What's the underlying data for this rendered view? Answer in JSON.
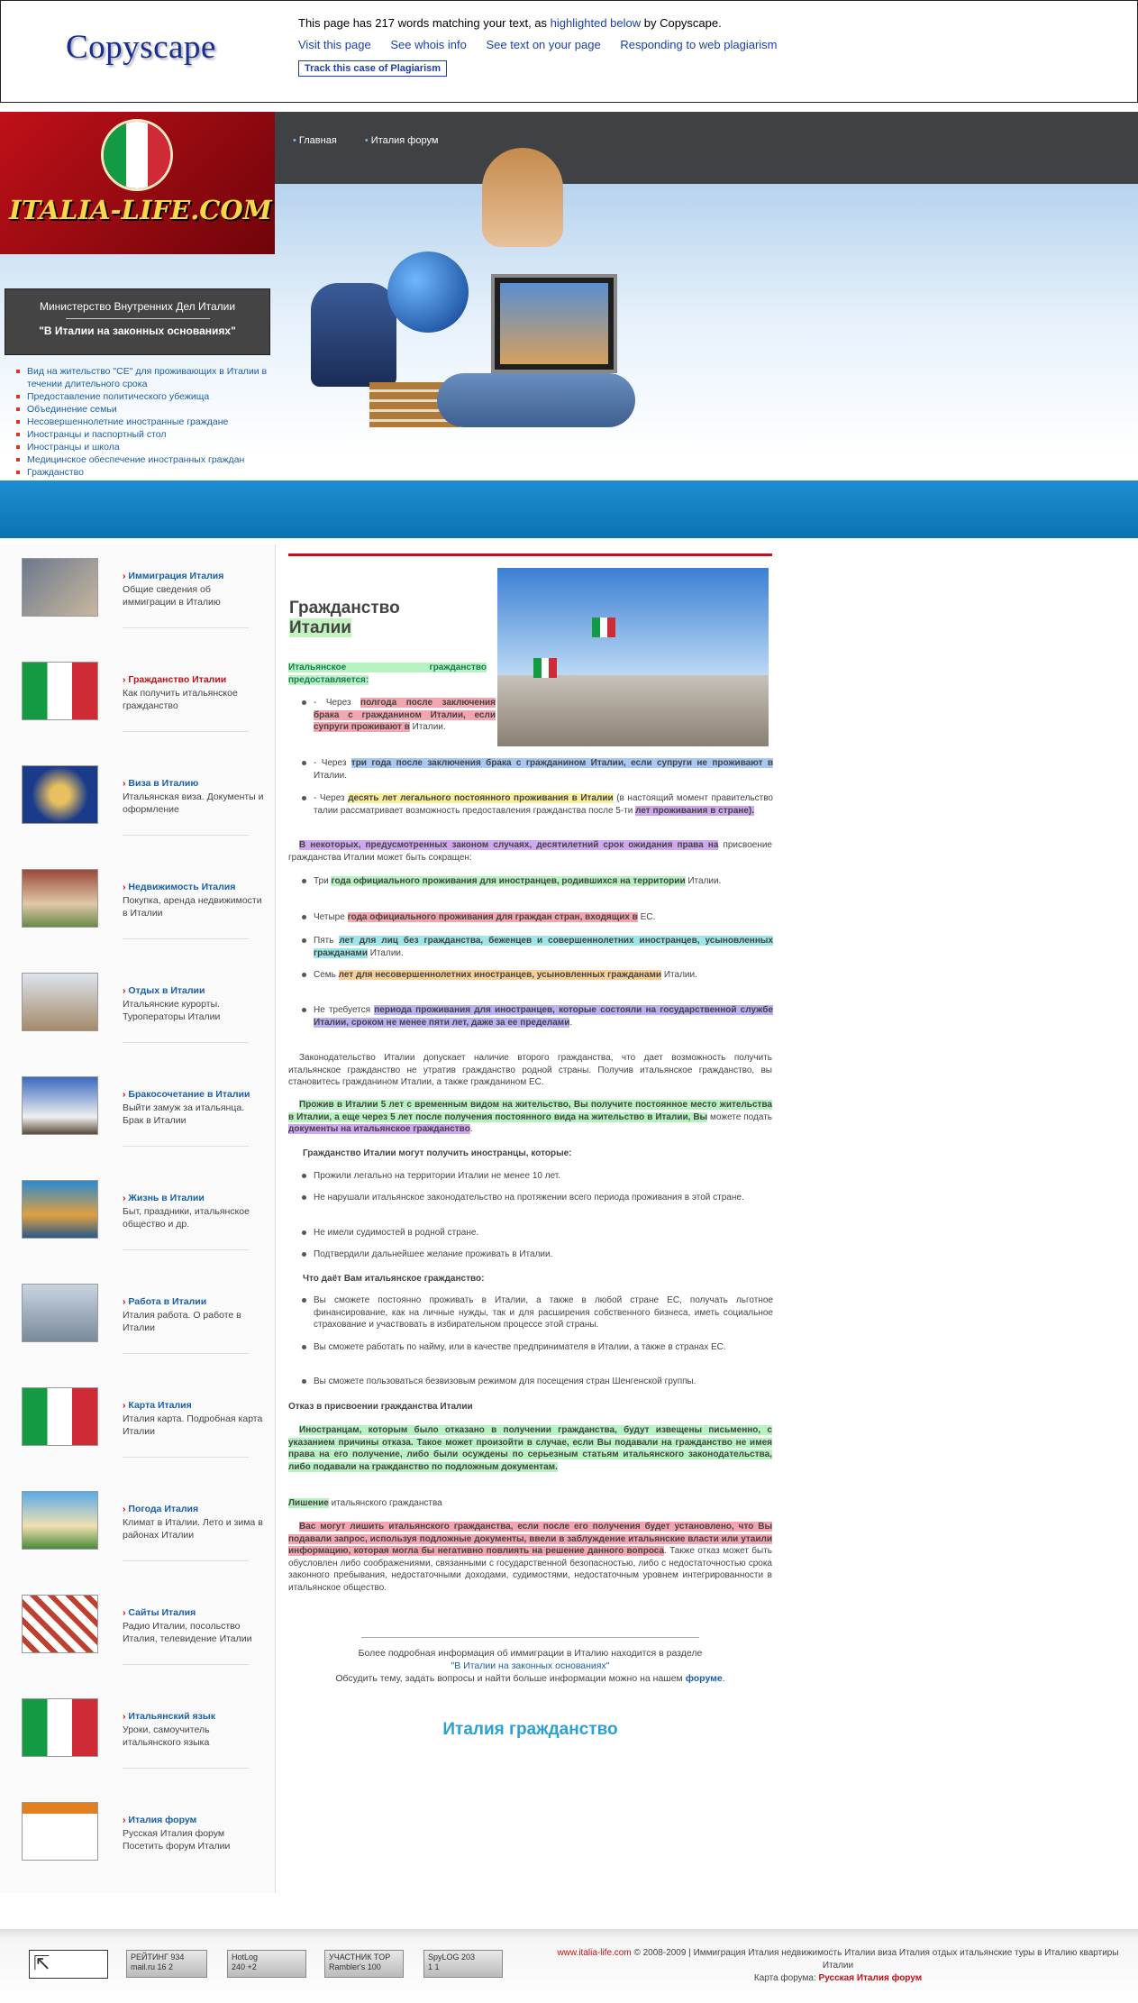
{
  "copyscape": {
    "logo": "Copyscape",
    "message_pre": "This page has 217 words matching your text, as ",
    "message_link": "highlighted below",
    "message_post": " by Copyscape.",
    "links": [
      "Visit this page",
      "See whois info",
      "See text on your page",
      "Responding to web plagiarism"
    ],
    "track_button": "Track this case of Plagiarism"
  },
  "header": {
    "logo_text": "ITALIA-LIFE.COM",
    "nav": [
      "Главная",
      "Италия форум"
    ],
    "ministry_title": "Министерство Внутренних Дел Италии",
    "ministry_subtitle": "\"В Италии на законных основаниях\"",
    "side_links": [
      "Вид на жительство \"CE\" для проживающих в Италии в течении длительного срока",
      "Предоставление политического убежища",
      "Объединение семьи",
      "Несовершеннолетние иностранные граждане",
      "Иностранцы и паспортный стол",
      "Иностранцы и школа",
      "Медицинское обеспечение иностранных граждан",
      "Гражданство"
    ]
  },
  "left_menu": [
    {
      "title": "Иммиграция Италия",
      "desc": "Общие сведения об иммиграции в Италию"
    },
    {
      "title": "Гражданство Италии",
      "desc": "Как получить итальянское гражданство"
    },
    {
      "title": "Виза в Италию",
      "desc": "Итальянская виза. Документы и оформление"
    },
    {
      "title": "Недвижимость Италия",
      "desc": "Покупка, аренда недвижимости в Италии"
    },
    {
      "title": "Отдых в Италии",
      "desc": "Итальянские курорты. Туроператоры Италии"
    },
    {
      "title": "Бракосочетание в Италии",
      "desc": "Выйти замуж за итальянца. Брак в Италии"
    },
    {
      "title": "Жизнь в Италии",
      "desc": "Быт, праздники, итальянское общество и др."
    },
    {
      "title": "Работа в Италии",
      "desc": "Италия работа. О работе в Италии"
    },
    {
      "title": "Карта Италия",
      "desc": "Италия карта. Подробная карта Италии"
    },
    {
      "title": "Погода Италия",
      "desc": "Климат в Италии. Лето и зима в районах Италии"
    },
    {
      "title": "Сайты Италия",
      "desc": "Радио Италии, посольство Италия, телевидение Италии"
    },
    {
      "title": "Итальянский язык",
      "desc": "Уроки, самоучитель итальянского языка"
    },
    {
      "title": "Италия форум",
      "desc": "Русская Италия форум Посетить форум Италии"
    }
  ],
  "content": {
    "title_line1": "Гражданство",
    "title_line2": "Италии",
    "intro": "Итальянское гражданство предоставляется:",
    "b1_a": "- Через ",
    "b1_b": "полгода после заключения брака с гражданином Италии, если супруги проживают в",
    "b1_c": " Италии.",
    "b2_a": "- Через ",
    "b2_b": "три года после заключения брака с гражданином Италии, если супруги не проживают в",
    "b2_c": " Италии.",
    "b3_a": "- Через ",
    "b3_b": "десять лет легального постоянного проживания в Италии",
    "b3_c": " (в настоящий момент правительство талии рассматривает возможность предоставления гражданства после 5-ти ",
    "b3_d": "лет проживания в стране).",
    "p1_a": "В некоторых, предусмотренных законом случаях, десятилетний срок ожидания права на",
    "p1_b": " присвоение гражданства Италии может быть сокращен:",
    "l1_a": "Три ",
    "l1_b": "года официального проживания для иностранцев, родившихся на территории",
    "l1_c": " Италии.",
    "l2_a": "Четыре ",
    "l2_b": "года официального проживания для граждан стран, входящих в",
    "l2_c": " ЕС.",
    "l3_a": "Пять ",
    "l3_b": "лет для лиц без гражданства, беженцев и совершеннолетних иностранцев, усыновленных гражданами",
    "l3_c": " Италии.",
    "l4_a": "Семь ",
    "l4_b": "лет для несовершеннолетних иностранцев, усыновленных гражданами",
    "l4_c": " Италии.",
    "l5_a": "Не требуется ",
    "l5_b": "периода проживания для иностранцев, которые состояли на государственной службе Италии, сроком не менее пяти лет, даже за ее пределами",
    "l5_c": ".",
    "p2": "Законодательство Италии допускает наличие второго гражданства, что дает возможность получить итальянское гражданство не утратив гражданство родной страны. Получив итальянское гражданство, вы становитесь гражданином Италии, а также гражданином ЕС.",
    "p3_a": "Прожив в Италии 5 лет с временным видом на жительство, Вы получите постоянное место жительства в Италии, а еще через 5 лет после получения постоянного вида на жительство в Италии, Вы",
    "p3_b": " можете подать ",
    "p3_c": "документы на итальянское гражданство",
    "p3_d": ".",
    "h_can": "Гражданство Италии могут получить иностранцы, которые:",
    "c1": "Прожили легально на территории Италии не менее 10 лет.",
    "c2": "Не нарушали итальянское законодательство на протяжении всего периода проживания в этой стране.",
    "c3": "Не имели судимостей в родной стране.",
    "c4": "Подтвердили дальнейшее желание проживать в Италии.",
    "h_gives": "Что даёт Вам итальянское гражданство:",
    "g1": "Вы сможете постоянно проживать в Италии, а также в любой стране ЕС, получать льготное финансирование, как на личные нужды, так и для расширения собственного бизнеса, иметь социальное страхование и участвовать в избирательном процессе этой страны.",
    "g2": "Вы сможете работать по найму, или в качестве предпринимателя в Италии, а также в странах ЕС.",
    "g3": "Вы сможете пользоваться безвизовым режимом для посещения стран Шенгенской группы.",
    "h_refusal": "Отказ в присвоении гражданства Италии",
    "p4": "Иностранцам, которым было отказано в получении гражданства, будут извещены письменно, с указанием причины отказа. Такое может произойти в случае, если Вы подавали на гражданство не имея права на его получение, либо были осуждены по серьезным статьям итальянского законодательства, либо подавали на гражданство по подложным документам.",
    "p5_a": "Лишение",
    "p5_b": " итальянского гражданства",
    "p6_a": "Вас могут лишить итальянского гражданства, если после его получения будет установлено, что Вы подавали запрос, используя подложные документы, ввели в заблуждение итальянские власти или утаили информацию, которая могла бы негативно повлиять на решение данного вопроса",
    "p6_b": ". Также отказ может быть обусловлен либо соображениями, связанными с государственной безопасностью, либо с недостаточностью срока законного пребывания, недостаточными доходами, судимостями, недостаточным уровнем интегрированности в итальянское общество.",
    "more_1": "Более подробная информация об иммиграции в Италию находится в разделе",
    "more_link": "\"В Италии на законных основаниях\"",
    "more_2_a": "Обсудить тему, задать вопросы и найти больше информации можно на нашем ",
    "more_2_link": "форуме",
    "more_2_b": ".",
    "bottom_title": "Италия гражданство"
  },
  "footer": {
    "arrow": "⇱",
    "counter1_top": "РЕЙТИНГ 934",
    "counter1_bot": "mail.ru 16 2",
    "counter2_top": "HotLog",
    "counter2_bot": "240 +2",
    "counter3_top": "УЧАСТНИК TOP",
    "counter3_bot": "Rambler's 100",
    "counter4_top": "SpyLOG 203",
    "counter4_bot": "1 1",
    "copy_site": "www.italia-life.com",
    "copy_text": " © 2008-2009 | Иммиграция Италия недвижимость Италии виза Италия отдых итальянские туры в Италию квартиры Италии",
    "copy_forum_label": "Карта форума: ",
    "copy_forum": "Русская Италия форум"
  }
}
